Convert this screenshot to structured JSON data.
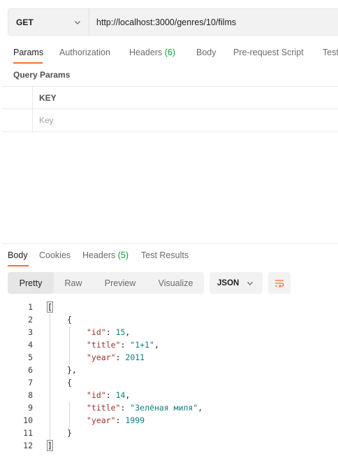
{
  "request": {
    "method": "GET",
    "url": "http://localhost:3000/genres/10/films"
  },
  "request_tabs": [
    {
      "label": "Params",
      "count": "",
      "active": true
    },
    {
      "label": "Authorization",
      "count": "",
      "active": false
    },
    {
      "label": "Headers",
      "count": "(6)",
      "active": false
    },
    {
      "label": "Body",
      "count": "",
      "active": false
    },
    {
      "label": "Pre-request Script",
      "count": "",
      "active": false
    },
    {
      "label": "Tests",
      "count": "",
      "active": false
    }
  ],
  "params": {
    "section_title": "Query Params",
    "column_key": "KEY",
    "key_placeholder": "Key"
  },
  "response_tabs": [
    {
      "label": "Body",
      "count": "",
      "active": true
    },
    {
      "label": "Cookies",
      "count": "",
      "active": false
    },
    {
      "label": "Headers",
      "count": "(5)",
      "active": false
    },
    {
      "label": "Test Results",
      "count": "",
      "active": false
    }
  ],
  "view_modes": [
    "Pretty",
    "Raw",
    "Preview",
    "Visualize"
  ],
  "active_view": "Pretty",
  "format": "JSON",
  "colors": {
    "accent": "#ff6c37",
    "count_green": "#0d9c3d",
    "json_key": "#9b2f2f",
    "json_value": "#0e7f7e"
  },
  "response_body": [
    {
      "n": "1",
      "indent": 0,
      "parts": [
        {
          "t": "[",
          "c": "punct"
        }
      ]
    },
    {
      "n": "2",
      "indent": 1,
      "parts": [
        {
          "t": "{",
          "c": "punct"
        }
      ]
    },
    {
      "n": "3",
      "indent": 2,
      "parts": [
        {
          "t": "\"id\"",
          "c": "key"
        },
        {
          "t": ": ",
          "c": "punct"
        },
        {
          "t": "15",
          "c": "num"
        },
        {
          "t": ",",
          "c": "punct"
        }
      ]
    },
    {
      "n": "4",
      "indent": 2,
      "parts": [
        {
          "t": "\"title\"",
          "c": "key"
        },
        {
          "t": ": ",
          "c": "punct"
        },
        {
          "t": "\"1+1\"",
          "c": "str"
        },
        {
          "t": ",",
          "c": "punct"
        }
      ]
    },
    {
      "n": "5",
      "indent": 2,
      "parts": [
        {
          "t": "\"year\"",
          "c": "key"
        },
        {
          "t": ": ",
          "c": "punct"
        },
        {
          "t": "2011",
          "c": "num"
        }
      ]
    },
    {
      "n": "6",
      "indent": 1,
      "parts": [
        {
          "t": "},",
          "c": "punct"
        }
      ]
    },
    {
      "n": "7",
      "indent": 1,
      "parts": [
        {
          "t": "{",
          "c": "punct"
        }
      ]
    },
    {
      "n": "8",
      "indent": 2,
      "parts": [
        {
          "t": "\"id\"",
          "c": "key"
        },
        {
          "t": ": ",
          "c": "punct"
        },
        {
          "t": "14",
          "c": "num"
        },
        {
          "t": ",",
          "c": "punct"
        }
      ]
    },
    {
      "n": "9",
      "indent": 2,
      "parts": [
        {
          "t": "\"title\"",
          "c": "key"
        },
        {
          "t": ": ",
          "c": "punct"
        },
        {
          "t": "\"Зелёная миля\"",
          "c": "str"
        },
        {
          "t": ",",
          "c": "punct"
        }
      ]
    },
    {
      "n": "10",
      "indent": 2,
      "parts": [
        {
          "t": "\"year\"",
          "c": "key"
        },
        {
          "t": ": ",
          "c": "punct"
        },
        {
          "t": "1999",
          "c": "num"
        }
      ]
    },
    {
      "n": "11",
      "indent": 1,
      "parts": [
        {
          "t": "}",
          "c": "punct"
        }
      ]
    },
    {
      "n": "12",
      "indent": 0,
      "parts": [
        {
          "t": "]",
          "c": "punct"
        }
      ]
    }
  ]
}
